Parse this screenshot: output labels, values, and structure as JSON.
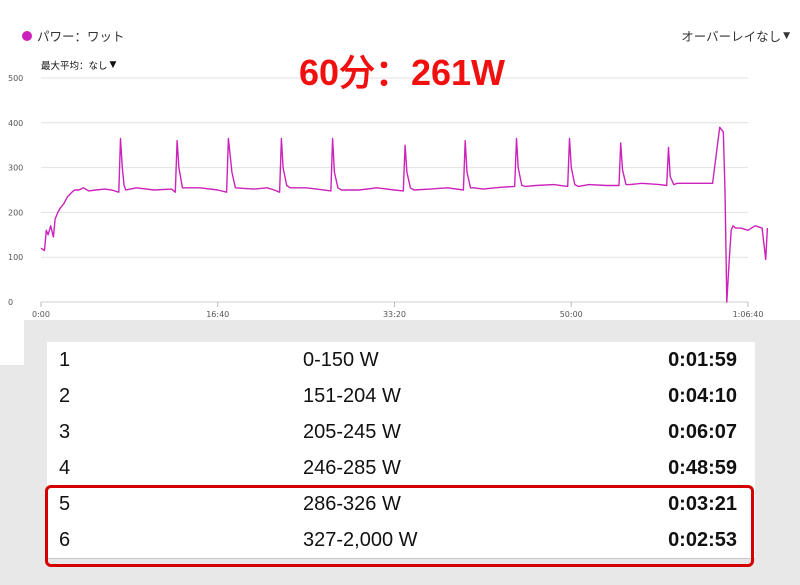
{
  "legend": {
    "label": "パワー：ワット",
    "color": "#cc22bb"
  },
  "overlay": {
    "label": "オーバーレイなし"
  },
  "max_avg": {
    "label": "最大平均：なし"
  },
  "title": "60分：261W",
  "chart_data": {
    "type": "line",
    "series_name": "パワー：ワット",
    "line_color": "#cc22bb",
    "x_unit": "h:mm",
    "x_ticks": [
      "0:00",
      "16:40",
      "33:20",
      "50:00",
      "1:06:40"
    ],
    "x_tick_seconds": [
      0,
      1000,
      2000,
      3000,
      4000
    ],
    "y_ticks": [
      "0",
      "100",
      "200",
      "300",
      "400",
      "500"
    ],
    "ylim": [
      0,
      500
    ],
    "xlim": [
      0,
      4000
    ],
    "grid": true,
    "x": [
      0,
      20,
      30,
      40,
      55,
      70,
      80,
      95,
      110,
      130,
      150,
      175,
      190,
      215,
      240,
      270,
      310,
      360,
      400,
      440,
      450,
      460,
      470,
      480,
      540,
      640,
      740,
      760,
      770,
      780,
      800,
      900,
      1000,
      1050,
      1060,
      1080,
      1100,
      1200,
      1280,
      1320,
      1350,
      1360,
      1370,
      1390,
      1410,
      1500,
      1560,
      1640,
      1650,
      1660,
      1680,
      1700,
      1800,
      1900,
      2000,
      2050,
      2060,
      2070,
      2090,
      2110,
      2200,
      2300,
      2390,
      2400,
      2410,
      2430,
      2450,
      2500,
      2600,
      2680,
      2690,
      2700,
      2720,
      2740,
      2800,
      2900,
      2980,
      2990,
      3000,
      3020,
      3040,
      3100,
      3200,
      3270,
      3280,
      3290,
      3310,
      3330,
      3400,
      3500,
      3540,
      3550,
      3560,
      3580,
      3600,
      3700,
      3800,
      3840,
      3860,
      3870,
      3880,
      3895,
      3905,
      3915,
      3930,
      3960,
      4000,
      4040,
      4080,
      4100,
      4110,
      4120
    ],
    "y": [
      120,
      115,
      160,
      150,
      170,
      145,
      185,
      200,
      210,
      220,
      235,
      245,
      250,
      250,
      255,
      248,
      250,
      252,
      250,
      245,
      365,
      300,
      260,
      250,
      255,
      250,
      252,
      245,
      360,
      300,
      255,
      255,
      250,
      245,
      365,
      290,
      255,
      252,
      255,
      250,
      245,
      365,
      300,
      260,
      255,
      255,
      252,
      248,
      365,
      290,
      255,
      250,
      250,
      255,
      250,
      248,
      350,
      290,
      255,
      250,
      252,
      255,
      250,
      360,
      290,
      255,
      255,
      252,
      256,
      258,
      365,
      300,
      260,
      258,
      260,
      262,
      258,
      365,
      300,
      262,
      258,
      262,
      260,
      260,
      355,
      295,
      262,
      262,
      265,
      262,
      260,
      345,
      280,
      262,
      265,
      265,
      265,
      390,
      380,
      250,
      0,
      100,
      160,
      170,
      165,
      165,
      160,
      170,
      165,
      95,
      165
    ]
  },
  "zones": [
    {
      "zone": "1",
      "range": "0-150 W",
      "time": "0:01:59"
    },
    {
      "zone": "2",
      "range": "151-204 W",
      "time": "0:04:10"
    },
    {
      "zone": "3",
      "range": "205-245 W",
      "time": "0:06:07"
    },
    {
      "zone": "4",
      "range": "246-285 W",
      "time": "0:48:59"
    },
    {
      "zone": "5",
      "range": "286-326 W",
      "time": "0:03:21"
    },
    {
      "zone": "6",
      "range": "327-2,000 W",
      "time": "0:02:53"
    }
  ]
}
